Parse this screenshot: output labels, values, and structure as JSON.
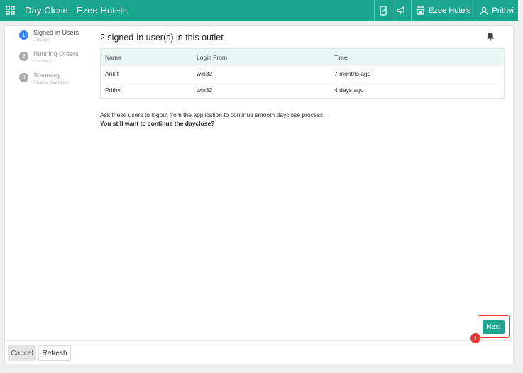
{
  "app": {
    "title": "Day Close - Ezee Hotels"
  },
  "topbar": {
    "outlet": "Ezee Hotels",
    "user": "Prithvi"
  },
  "steps": [
    {
      "label": "Signed-in Users",
      "sub": "2 user(s)",
      "num": "1"
    },
    {
      "label": "Running Orders",
      "sub": "0 order(s)",
      "num": "2"
    },
    {
      "label": "Summary",
      "sub": "Finalize Day Close",
      "num": "3"
    }
  ],
  "main": {
    "heading": "2 signed-in user(s) in this outlet",
    "columns": [
      "Name",
      "Login From",
      "Time"
    ],
    "rows": [
      [
        "Ankit",
        "win32",
        "7 months ago"
      ],
      [
        "Prithvi",
        "win32",
        "4 days ago"
      ]
    ],
    "note": "Ask these users to logout from the application to continue smooth dayclose process.",
    "question": "You still want to continue the dayclose?"
  },
  "footer": {
    "cancel": "Cancel",
    "refresh": "Refresh",
    "next": "Next"
  },
  "annotation": {
    "marker": "1"
  },
  "colors": {
    "brand": "#1aa68f",
    "active_step": "#3b82f6",
    "highlight": "#e53935"
  }
}
